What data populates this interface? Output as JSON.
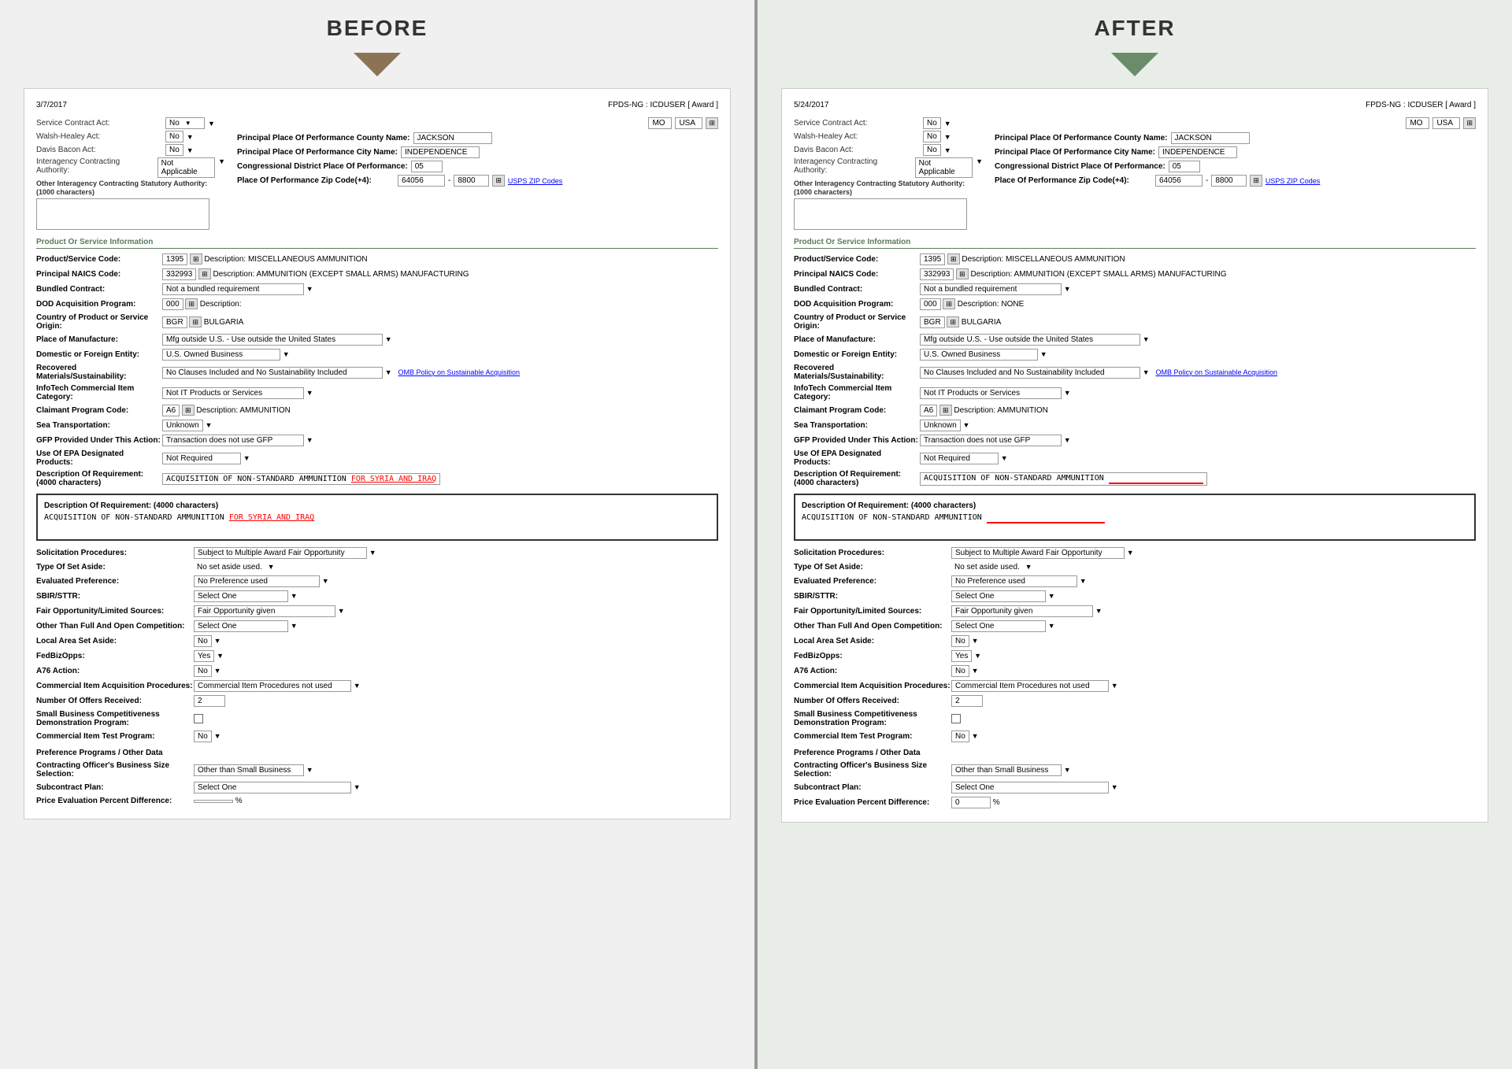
{
  "before": {
    "title": "BEFORE",
    "date": "3/7/2017",
    "system": "FPDS-NG : ICDUSER [ Award ]",
    "location_state": "MO",
    "location_country": "USA",
    "county_name": "JACKSON",
    "city_name": "INDEPENDENCE",
    "congressional_district": "05",
    "zip_code": "64056",
    "zip_ext": "8800",
    "zip_link": "USPS ZIP Codes",
    "service_contract_act": "No",
    "walsh_healey_act": "No",
    "davis_bacon_act": "No",
    "interagency_contracting": "Not Applicable",
    "product_service_code": "1395",
    "psc_desc": "MISCELLANEOUS AMMUNITION",
    "naics_code": "332993",
    "naics_desc": "AMMUNITION (EXCEPT SMALL ARMS) MANUFACTURING",
    "bundled_contract": "Not a bundled requirement",
    "dod_program": "000",
    "dod_desc": "Description:",
    "country_origin": "BGR",
    "country_name": "BULGARIA",
    "place_manufacture": "Mfg outside U.S. - Use outside the United States",
    "domestic_foreign": "U.S. Owned Business",
    "recovered_materials": "No Clauses Included and No Sustainability Included",
    "infotech_category": "Not IT Products or Services",
    "claimant_code": "A6",
    "claimant_desc": "AMMUNITION",
    "sea_transportation": "Unknown",
    "gfp_action": "Transaction does not use GFP",
    "epa_products": "Not Required",
    "description_req": "ACQUISITION OF NON-STANDARD AMMUNITION FOR SYRIA AND IRAQ",
    "description_req_box": "ACQUISITION OF NON-STANDARD AMMUNITION FOR SYRIA AND IRAQ",
    "highlight_text": "FOR SYRIA AND IRAQ",
    "solicitation_procedures": "Subject to Multiple Award Fair Opportunity",
    "type_set_aside": "No set aside used.",
    "evaluated_preference": "No Preference used",
    "sbir_sttr": "Select One",
    "fair_opportunity": "Fair Opportunity given",
    "other_full_open": "Select One",
    "local_area": "No",
    "fedbizopps": "Yes",
    "a76_action": "No",
    "commercial_item_proc": "Commercial Item Procedures not used",
    "number_offers": "2",
    "small_business_demo": "",
    "commercial_item_test": "No",
    "contracting_officer_size": "Other than Small Business",
    "subcontract_plan": "Select One",
    "price_eval_percent": "",
    "omb_link": "OMB Policy on Sustainable Acquisition"
  },
  "after": {
    "title": "AFTER",
    "date": "5/24/2017",
    "system": "FPDS-NG : ICDUSER [ Award ]",
    "location_state": "MO",
    "location_country": "USA",
    "county_name": "JACKSON",
    "city_name": "INDEPENDENCE",
    "congressional_district": "05",
    "zip_code": "64056",
    "zip_ext": "8800",
    "zip_link": "USPS ZIP Codes",
    "service_contract_act": "No",
    "walsh_healey_act": "No",
    "davis_bacon_act": "No",
    "interagency_contracting": "Not Applicable",
    "product_service_code": "1395",
    "psc_desc": "MISCELLANEOUS AMMUNITION",
    "naics_code": "332993",
    "naics_desc": "AMMUNITION (EXCEPT SMALL ARMS) MANUFACTURING",
    "bundled_contract": "Not a bundled requirement",
    "dod_program": "000",
    "dod_desc": "Description: NONE",
    "country_origin": "BGR",
    "country_name": "BULGARIA",
    "place_manufacture": "Mfg outside U.S. - Use outside the United States",
    "domestic_foreign": "U.S. Owned Business",
    "recovered_materials": "No Clauses Included and No Sustainability Included",
    "infotech_category": "Not IT Products or Services",
    "claimant_code": "A6",
    "claimant_desc": "AMMUNITION",
    "sea_transportation": "Unknown",
    "gfp_action": "Transaction does not use GFP",
    "epa_products": "Not Required",
    "description_req": "ACQUISITION OF NON-STANDARD AMMUNITION",
    "description_req_box": "ACQUISITION OF NON-STANDARD AMMUNITION",
    "solicitation_procedures": "Subject to Multiple Award Fair Opportunity",
    "type_set_aside": "No set aside used.",
    "evaluated_preference": "No Preference used",
    "sbir_sttr": "Select One",
    "fair_opportunity": "Fair Opportunity given",
    "other_full_open": "Select One",
    "local_area": "No",
    "fedbizopps": "Yes",
    "a76_action": "No",
    "commercial_item_proc": "Commercial Item Procedures not used",
    "number_offers": "2",
    "small_business_demo": "",
    "commercial_item_test": "No",
    "contracting_officer_size": "Other than Small Business",
    "subcontract_plan": "Select One",
    "price_eval_percent": "0",
    "omb_link": "OMB Policy on Sustainable Acquisition"
  },
  "labels": {
    "service_contract_act": "Service Contract Act:",
    "walsh_healey_act": "Walsh-Healey Act:",
    "davis_bacon_act": "Davis Bacon Act:",
    "interagency_contracting": "Interagency Contracting Authority:",
    "other_statutory": "Other Interagency Contracting Statutory Authority: (1000 characters)",
    "principal_county": "Principal Place Of Performance County Name:",
    "principal_city": "Principal Place Of Performance City Name:",
    "congressional_district": "Congressional District Place Of Performance:",
    "zip_code": "Place Of Performance Zip Code(+4):",
    "product_service": "Product/Service Code:",
    "naics": "Principal NAICS Code:",
    "bundled": "Bundled Contract:",
    "dod_program": "DOD Acquisition Program:",
    "country_origin": "Country of Product or Service Origin:",
    "place_manufacture": "Place of Manufacture:",
    "domestic_foreign": "Domestic or Foreign Entity:",
    "recovered_materials": "Recovered Materials/Sustainability:",
    "infotech": "InfoTech Commercial Item Category:",
    "claimant": "Claimant Program Code:",
    "sea_transportation": "Sea Transportation:",
    "gfp": "GFP Provided Under This Action:",
    "epa": "Use Of EPA Designated Products:",
    "description": "Description Of Requirement: (4000 characters)",
    "solicitation": "Solicitation Procedures:",
    "type_set_aside": "Type Of Set Aside:",
    "evaluated_pref": "Evaluated Preference:",
    "sbir_sttr": "SBIR/STTR:",
    "fair_opportunity": "Fair Opportunity/Limited Sources:",
    "other_full_open": "Other Than Full And Open Competition:",
    "local_area": "Local Area Set Aside:",
    "fedbizopps": "FedBizOpps:",
    "a76": "A76 Action:",
    "commercial_item_proc": "Commercial Item Acquisition Procedures:",
    "number_offers": "Number Of Offers Received:",
    "small_business": "Small Business Competitiveness Demonstration Program:",
    "commercial_item_test": "Commercial Item Test Program:",
    "pref_header": "Preference Programs / Other Data",
    "contracting_officer": "Contracting Officer's Business Size Selection:",
    "subcontract": "Subcontract Plan:",
    "price_eval": "Price Evaluation Percent Difference:",
    "section_title": "Product Or Service Information"
  }
}
